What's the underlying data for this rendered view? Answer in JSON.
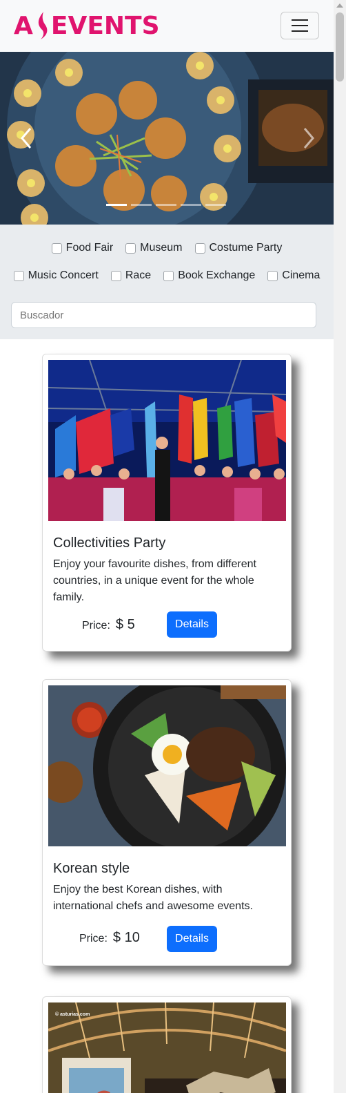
{
  "brand": {
    "name": "EVENTS",
    "initial": "A"
  },
  "navbar": {
    "toggle_icon": "hamburger-icon"
  },
  "carousel": {
    "slides": 5,
    "active_index": 0,
    "prev_icon": "chevron-left-icon",
    "next_icon": "chevron-right-icon"
  },
  "filters": {
    "categories": [
      "Food Fair",
      "Museum",
      "Costume Party",
      "Music Concert",
      "Race",
      "Book Exchange",
      "Cinema"
    ],
    "search_placeholder": "Buscador"
  },
  "events": [
    {
      "title": "Collectivities Party",
      "description": "Enjoy your favourite dishes, from different countries, in a unique event for the whole family.",
      "price_label": "Price:",
      "price": "$ 5",
      "button": "Details"
    },
    {
      "title": "Korean style",
      "description": "Enjoy the best Korean dishes, with international chefs and awesome events.",
      "price_label": "Price:",
      "price": "$ 10",
      "button": "Details"
    },
    {
      "image_caption": "© asturias.com"
    }
  ],
  "colors": {
    "brand": "#e0146e",
    "button": "#0d6efd",
    "filter_bg": "#e9ecef",
    "nav_bg": "#f8f9fa"
  }
}
